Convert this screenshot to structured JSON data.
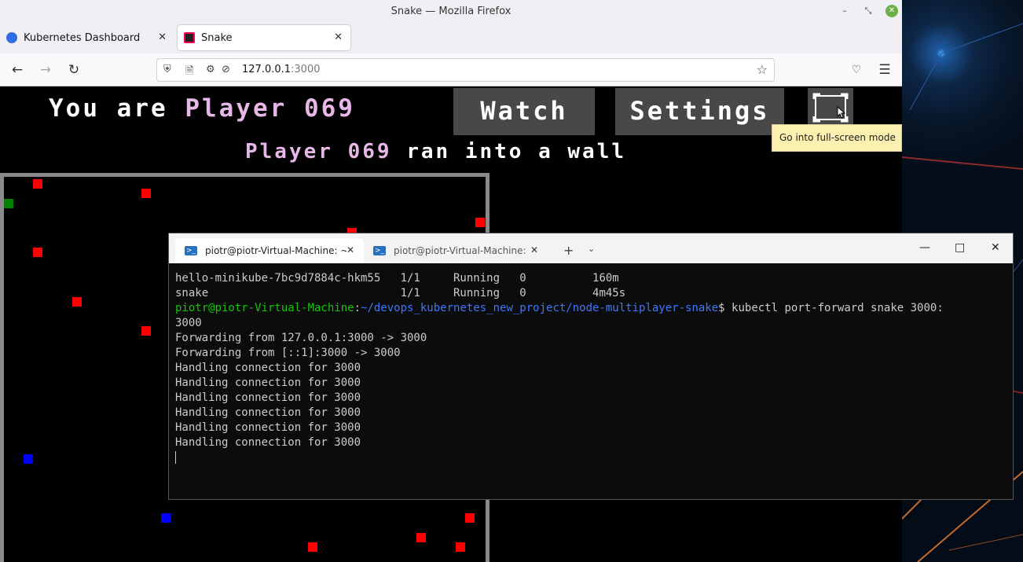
{
  "browser": {
    "window_title": "Snake — Mozilla Firefox",
    "tabs": [
      {
        "label": "Kubernetes Dashboard"
      },
      {
        "label": "Snake"
      }
    ],
    "url_host": "127.0.0.1",
    "url_port": ":3000"
  },
  "game": {
    "you_are": "You are ",
    "player_name": "Player 069",
    "watch_label": "Watch",
    "settings_label": "Settings",
    "fullscreen_tooltip": "Go into full-screen mode",
    "status_player": "Player 069",
    "status_text": " ran into a wall",
    "colors": {
      "food": "#ff0000",
      "snake_self": "#008000",
      "snake_other": "#0000ff",
      "border": "#8a8a8a"
    }
  },
  "terminal": {
    "tabs": [
      {
        "label": "piotr@piotr-Virtual-Machine: ~"
      },
      {
        "label": "piotr@piotr-Virtual-Machine: ~"
      }
    ],
    "line1": "hello-minikube-7bc9d7884c-hkm55   1/1     Running   0          160m",
    "line2": "snake                             1/1     Running   0          4m45s",
    "prompt_user": "piotr@piotr-Virtual-Machine",
    "prompt_colon": ":",
    "prompt_path": "~/devops_kubernetes_new_project/node-multiplayer-snake",
    "prompt_cmd": "$ kubectl port-forward snake 3000:",
    "line_wrap": "3000",
    "line_fwd1": "Forwarding from 127.0.0.1:3000 -> 3000",
    "line_fwd2": "Forwarding from [::1]:3000 -> 3000",
    "handling": [
      "Handling connection for 3000",
      "Handling connection for 3000",
      "Handling connection for 3000",
      "Handling connection for 3000",
      "Handling connection for 3000",
      "Handling connection for 3000"
    ]
  }
}
